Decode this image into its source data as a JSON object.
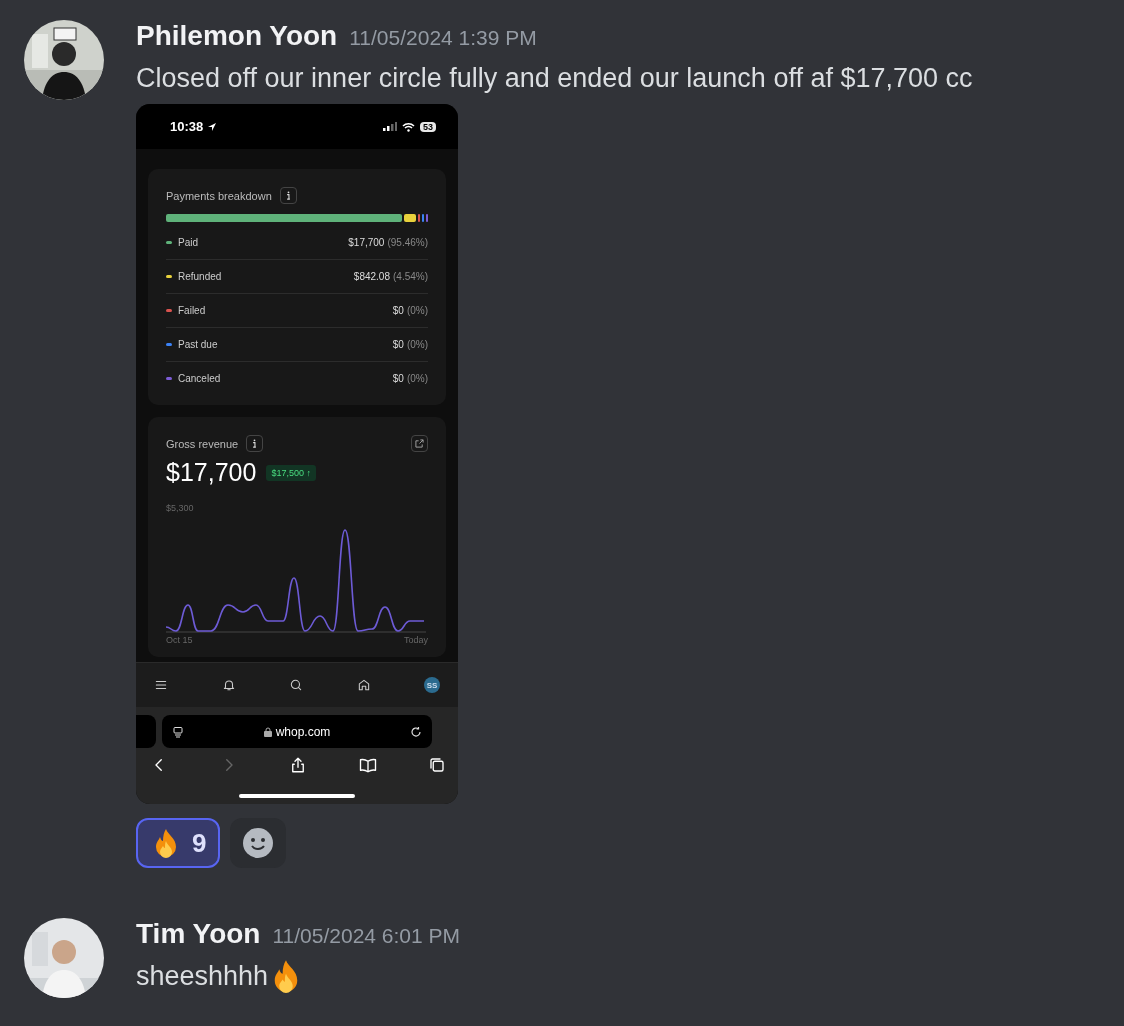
{
  "messages": [
    {
      "author": "Philemon Yoon",
      "timestamp": "11/05/2024 1:39 PM",
      "text": "Closed off our inner circle fully and ended our launch off af $17,700 cc",
      "kind": "screenshot",
      "screenshot": {
        "status_bar": {
          "time": "10:38",
          "battery": "53"
        },
        "payments": {
          "title": "Payments breakdown",
          "rows": [
            {
              "label": "Paid",
              "amount": "$17,700",
              "share": "(95.46%)",
              "color": "#5fb27a"
            },
            {
              "label": "Refunded",
              "amount": "$842.08",
              "share": "(4.54%)",
              "color": "#e8d13c"
            },
            {
              "label": "Failed",
              "amount": "$0",
              "share": "(0%)",
              "color": "#d9534f"
            },
            {
              "label": "Past due",
              "amount": "$0",
              "share": "(0%)",
              "color": "#3b82f6"
            },
            {
              "label": "Canceled",
              "amount": "$0",
              "share": "(0%)",
              "color": "#7c5cd6"
            }
          ]
        },
        "revenue": {
          "title": "Gross revenue",
          "total": "$17,700",
          "change": "$17,500 ↑",
          "y_label": "$5,300",
          "start_label": "Oct 15",
          "end_label": "Today"
        },
        "nav": {
          "avatar_initials": "SS"
        },
        "browser": {
          "url": "whop.com"
        }
      },
      "reactions": [
        {
          "count": "9",
          "selected": true
        }
      ]
    },
    {
      "author": "Tim Yoon",
      "timestamp": "11/05/2024 6:01 PM",
      "text": "sheeshhhh",
      "kind": "text"
    }
  ]
}
